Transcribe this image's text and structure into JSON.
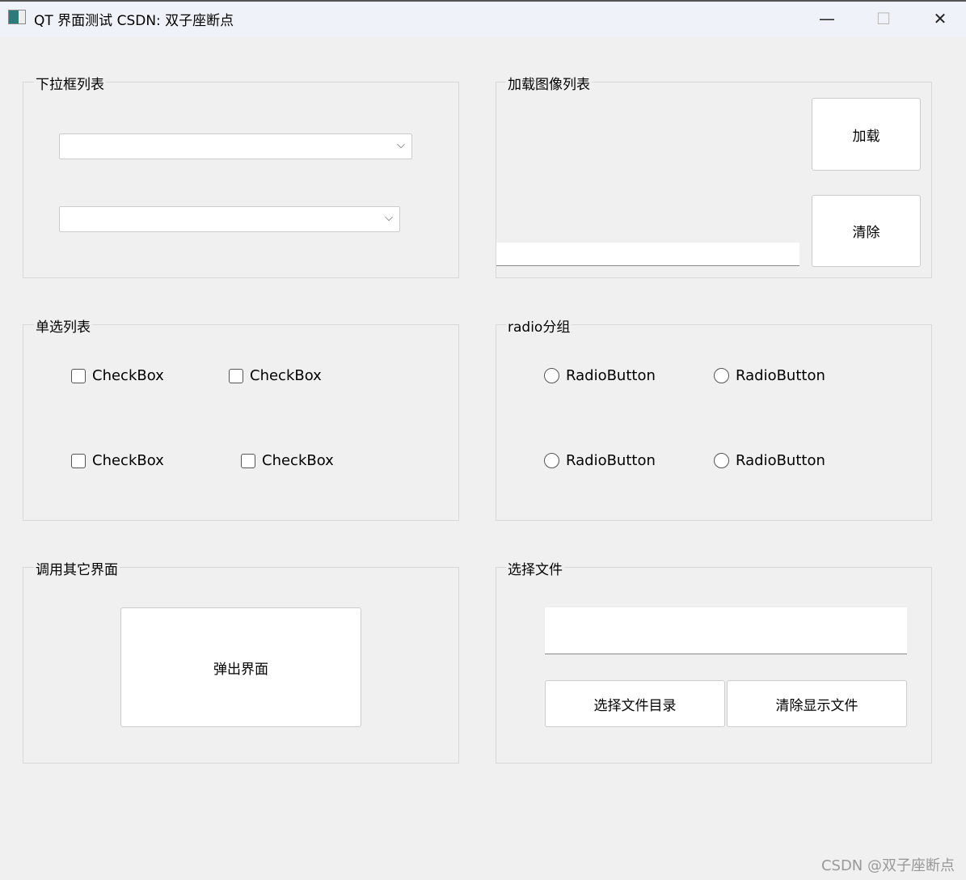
{
  "window": {
    "title": "QT 界面测试 CSDN: 双子座断点",
    "minimize": "—",
    "maximize": "☐",
    "close": "✕"
  },
  "groups": {
    "combo": {
      "title": "下拉框列表"
    },
    "image": {
      "title": "加载图像列表",
      "load": "加载",
      "clear": "清除"
    },
    "check": {
      "title": "单选列表",
      "items": [
        "CheckBox",
        "CheckBox",
        "CheckBox",
        "CheckBox"
      ]
    },
    "radio": {
      "title": "radio分组",
      "items": [
        "RadioButton",
        "RadioButton",
        "RadioButton",
        "RadioButton"
      ]
    },
    "other": {
      "title": "调用其它界面",
      "popup": "弹出界面"
    },
    "file": {
      "title": "选择文件",
      "select": "选择文件目录",
      "clear": "清除显示文件"
    }
  },
  "watermark": "CSDN @双子座断点"
}
